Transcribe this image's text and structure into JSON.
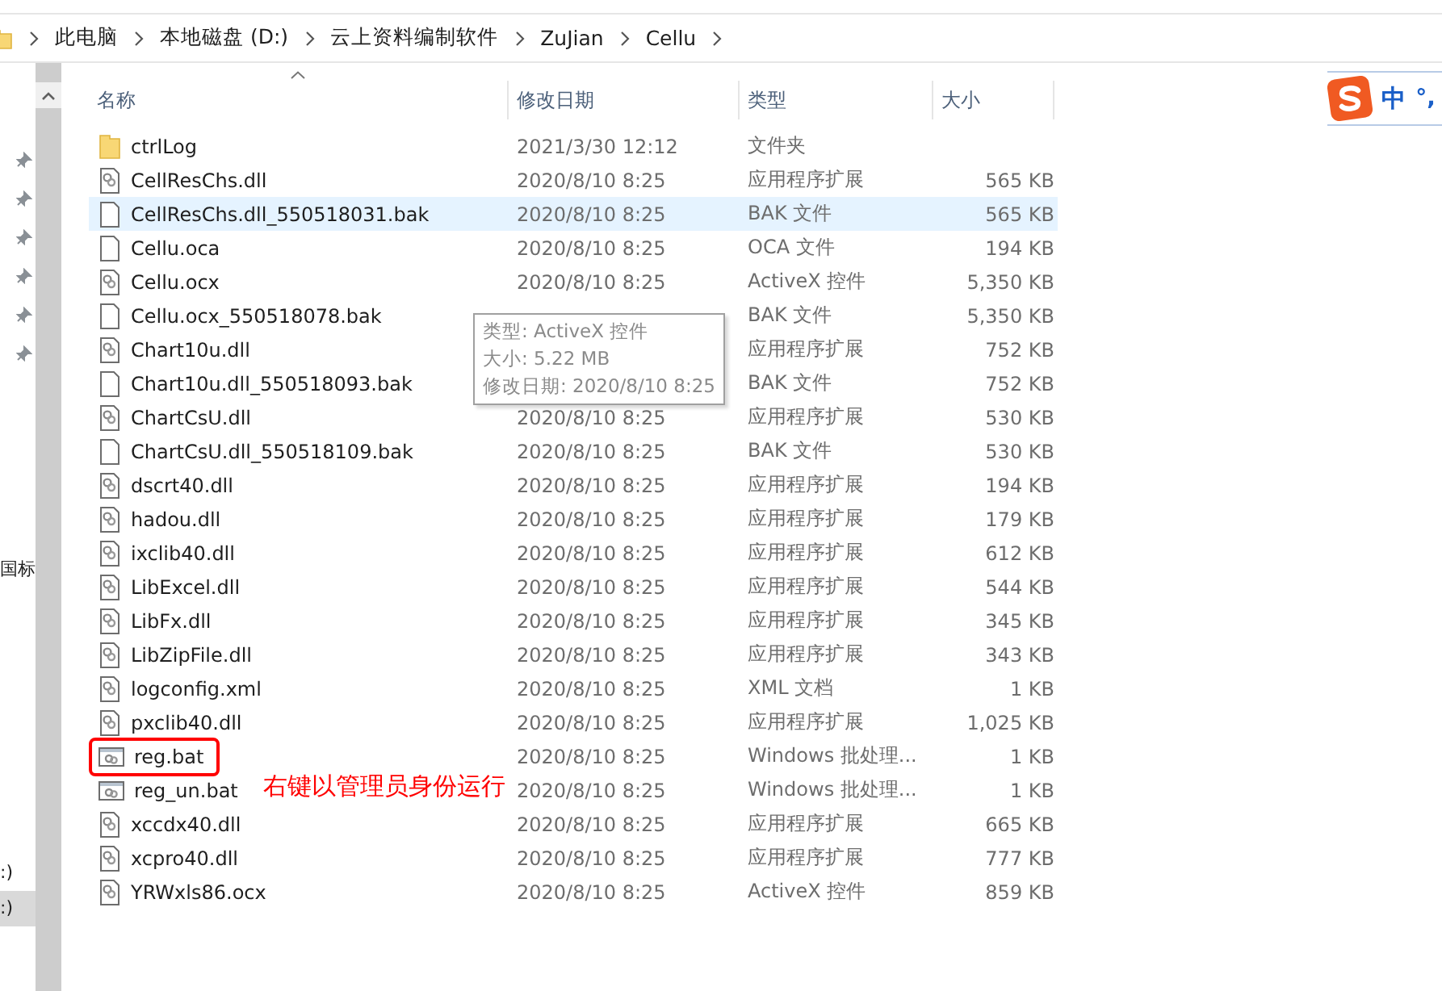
{
  "breadcrumb": [
    "此电脑",
    "本地磁盘 (D:)",
    "云上资料编制软件",
    "ZuJian",
    "Cellu"
  ],
  "nav": {
    "items": [
      {
        "label": "国标",
        "selected": false
      },
      {
        "label": ":)",
        "selected": false
      },
      {
        "label": ":)",
        "selected": true
      }
    ]
  },
  "columns": [
    "名称",
    "修改日期",
    "类型",
    "大小"
  ],
  "files": [
    {
      "name": "ctrlLog",
      "date": "2021/3/30 12:12",
      "type": "文件夹",
      "kind": "folder",
      "selected": false,
      "highlighted": false
    },
    {
      "name": "CellResChs.dll",
      "date": "2020/8/10 8:25",
      "type": "应用程序扩展",
      "size": "565 KB",
      "kind": "gear",
      "selected": false,
      "highlighted": false
    },
    {
      "name": "CellResChs.dll_550518031.bak",
      "date": "2020/8/10 8:25",
      "type": "BAK 文件",
      "size": "565 KB",
      "kind": "blank",
      "selected": true,
      "highlighted": false
    },
    {
      "name": "Cellu.oca",
      "date": "2020/8/10 8:25",
      "type": "OCA 文件",
      "size": "194 KB",
      "kind": "blank",
      "selected": false,
      "highlighted": false
    },
    {
      "name": "Cellu.ocx",
      "date": "2020/8/10 8:25",
      "type": "ActiveX 控件",
      "size": "5,350 KB",
      "kind": "gear",
      "selected": false,
      "highlighted": false
    },
    {
      "name": "Cellu.ocx_550518078.bak",
      "type": "BAK 文件",
      "size": "5,350 KB",
      "kind": "blank",
      "selected": false,
      "highlighted": false
    },
    {
      "name": "Chart10u.dll",
      "type": "应用程序扩展",
      "size": "752 KB",
      "kind": "gear",
      "selected": false,
      "highlighted": false
    },
    {
      "name": "Chart10u.dll_550518093.bak",
      "type": "BAK 文件",
      "size": "752 KB",
      "kind": "blank",
      "selected": false,
      "highlighted": false
    },
    {
      "name": "ChartCsU.dll",
      "date": "2020/8/10 8:25",
      "type": "应用程序扩展",
      "size": "530 KB",
      "kind": "gear",
      "selected": false,
      "highlighted": false
    },
    {
      "name": "ChartCsU.dll_550518109.bak",
      "date": "2020/8/10 8:25",
      "type": "BAK 文件",
      "size": "530 KB",
      "kind": "blank",
      "selected": false,
      "highlighted": false
    },
    {
      "name": "dscrt40.dll",
      "date": "2020/8/10 8:25",
      "type": "应用程序扩展",
      "size": "194 KB",
      "kind": "gear",
      "selected": false,
      "highlighted": false
    },
    {
      "name": "hadou.dll",
      "date": "2020/8/10 8:25",
      "type": "应用程序扩展",
      "size": "179 KB",
      "kind": "gear",
      "selected": false,
      "highlighted": false
    },
    {
      "name": "ixclib40.dll",
      "date": "2020/8/10 8:25",
      "type": "应用程序扩展",
      "size": "612 KB",
      "kind": "gear",
      "selected": false,
      "highlighted": false
    },
    {
      "name": "LibExcel.dll",
      "date": "2020/8/10 8:25",
      "type": "应用程序扩展",
      "size": "544 KB",
      "kind": "gear",
      "selected": false,
      "highlighted": false
    },
    {
      "name": "LibFx.dll",
      "date": "2020/8/10 8:25",
      "type": "应用程序扩展",
      "size": "345 KB",
      "kind": "gear",
      "selected": false,
      "highlighted": false
    },
    {
      "name": "LibZipFile.dll",
      "date": "2020/8/10 8:25",
      "type": "应用程序扩展",
      "size": "343 KB",
      "kind": "gear",
      "selected": false,
      "highlighted": false
    },
    {
      "name": "logconfig.xml",
      "date": "2020/8/10 8:25",
      "type": "XML 文档",
      "size": "1 KB",
      "kind": "gear",
      "selected": false,
      "highlighted": false
    },
    {
      "name": "pxclib40.dll",
      "date": "2020/8/10 8:25",
      "type": "应用程序扩展",
      "size": "1,025 KB",
      "kind": "gear",
      "selected": false,
      "highlighted": false
    },
    {
      "name": "reg.bat",
      "date": "2020/8/10 8:25",
      "type": "Windows 批处理...",
      "size": "1 KB",
      "kind": "batch",
      "selected": false,
      "highlighted": true
    },
    {
      "name": "reg_un.bat",
      "date": "2020/8/10 8:25",
      "type": "Windows 批处理...",
      "size": "1 KB",
      "kind": "batch",
      "selected": false,
      "highlighted": false
    },
    {
      "name": "xccdx40.dll",
      "date": "2020/8/10 8:25",
      "type": "应用程序扩展",
      "size": "665 KB",
      "kind": "gear",
      "selected": false,
      "highlighted": false
    },
    {
      "name": "xcpro40.dll",
      "date": "2020/8/10 8:25",
      "type": "应用程序扩展",
      "size": "777 KB",
      "kind": "gear",
      "selected": false,
      "highlighted": false
    },
    {
      "name": "YRWxls86.ocx",
      "date": "2020/8/10 8:25",
      "type": "ActiveX 控件",
      "size": "859 KB",
      "kind": "gear",
      "selected": false,
      "highlighted": false
    }
  ],
  "tooltip": [
    "类型: ActiveX 控件",
    "大小: 5.22 MB",
    "修改日期: 2020/8/10 8:25"
  ],
  "annotation": "右键以管理员身份运行",
  "ime": {
    "mode": "中",
    "punct": "°,"
  }
}
